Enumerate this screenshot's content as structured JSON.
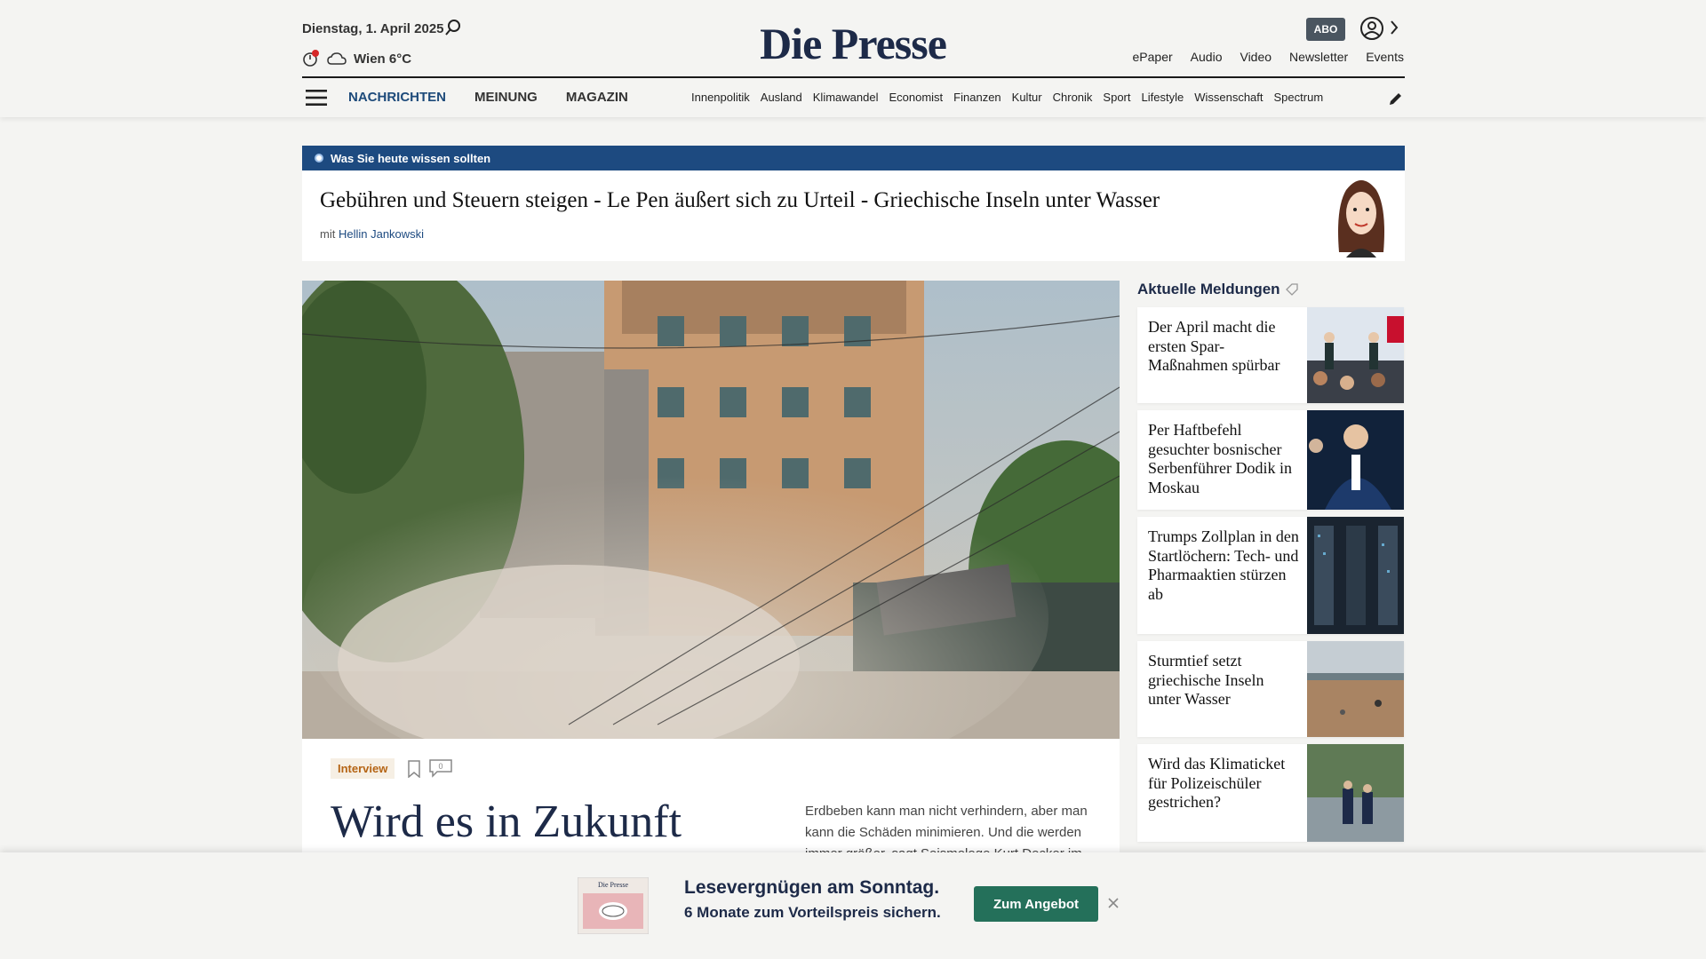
{
  "header": {
    "date": "Dienstag, 1. April 2025",
    "weather": "Wien 6°C",
    "logo": "Die Presse",
    "abo": "ABO",
    "top_links": [
      "ePaper",
      "Audio",
      "Video",
      "Newsletter",
      "Events"
    ],
    "main_nav": [
      "NACHRICHTEN",
      "MEINUNG",
      "MAGAZIN"
    ],
    "sub_nav": [
      "Innenpolitik",
      "Ausland",
      "Klimawandel",
      "Economist",
      "Finanzen",
      "Kultur",
      "Chronik",
      "Sport",
      "Lifestyle",
      "Wissenschaft",
      "Spectrum"
    ]
  },
  "briefing": {
    "label": "Was Sie heute wissen sollten",
    "headline": "Gebühren und Steuern steigen - Le Pen äußert sich zu Urteil - Griechische Inseln unter Wasser",
    "author_prefix": "mit",
    "author": "Hellin Jankowski"
  },
  "article": {
    "tag": "Interview",
    "comments": "0",
    "title": "Wird es in Zukunft",
    "lead": "Erdbeben kann man nicht verhindern, aber man kann die Schäden minimieren. Und die werden immer größer, sagt Seismologe Kurt Decker im"
  },
  "sidebar": {
    "title": "Aktuelle Meldungen",
    "items": [
      {
        "text": "Der April macht die ersten Spar-Maßnahmen spürbar"
      },
      {
        "text": "Per Haftbefehl gesuchter bosnischer Serbenführer Dodik in Moskau"
      },
      {
        "text": "Trumps Zollplan in den Startlöchern: Tech- und Pharmaaktien stürzen ab"
      },
      {
        "text": "Sturmtief setzt griechische Inseln unter Wasser"
      },
      {
        "text": "Wird das Klimaticket für Polizeischüler gestrichen?"
      }
    ]
  },
  "banner": {
    "title": "Lesevergnügen am Sonntag.",
    "subtitle": "6 Monate zum Vorteilspreis sichern.",
    "cta": "Zum Angebot",
    "thumb_label": "Die Presse"
  },
  "colors": {
    "brand_navy": "#1d2a48",
    "briefing_blue": "#1d4a80",
    "cta_green": "#24705a",
    "tag_orange": "#b56414"
  }
}
